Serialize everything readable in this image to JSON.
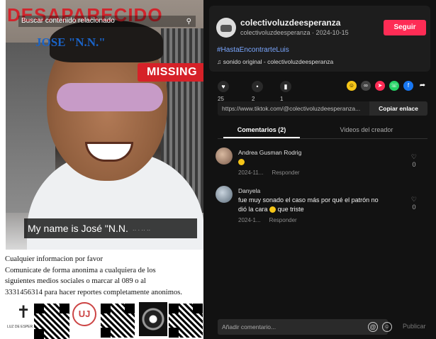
{
  "poster": {
    "headline": "DESAPARECIDO",
    "search_overlay": "Buscar contenido relacionado",
    "name_overlay": "JOSE \"N.N.\"",
    "missing_badge": "MISSING",
    "caption_text": "My name is José \"N.N.",
    "caption_tail": "·· ·  ·· ··",
    "info_lines": [
      "Cualquier informacion por favor",
      "Comunicate de forma anonima a cualquiera de los",
      "siguientes medios sociales o marcar al 089 o al",
      "3331456314 para hacer reportes completamente anonimos."
    ],
    "logo_caption": "LUZ DE ESPERANZA",
    "colors": {
      "headline": "#d1242c",
      "missing": "#d62128",
      "name": "#1a63c7"
    }
  },
  "post": {
    "username": "colectivoluzdeesperanza",
    "meta": "colectivoluzdeesperanza · 2024-10-15",
    "follow_label": "Seguir",
    "hashtag": "#HastaEncontrarteLuis",
    "sound": "sonido original - colectivoluzdeesperanza",
    "colors": {
      "follow": "#fe2c55",
      "hashtag": "#7aa7ff"
    }
  },
  "actions": {
    "likes": "25",
    "comments": "2",
    "saves": "1"
  },
  "link": {
    "url": "https://www.tiktok.com/@colectivoluzdeesperanza...",
    "copy_label": "Copiar enlace"
  },
  "tabs": [
    {
      "label": "Comentarios (2)",
      "active": true
    },
    {
      "label": "Videos del creador",
      "active": false
    }
  ],
  "comments": [
    {
      "name": "Andrea Gusman Rodrig",
      "text": "",
      "date": "2024-11...",
      "reply": "Responder",
      "likes": "0"
    },
    {
      "name": "Danyela",
      "text_line1": "fue muy sonado el caso más por qué el patrón no",
      "text_line2": "dió la cara",
      "text_line2_tail": "que triste",
      "date": "2024-1...",
      "reply": "Responder",
      "likes": "0"
    }
  ],
  "composer": {
    "placeholder": "Añadir comentario...",
    "publish_label": "Publicar"
  }
}
